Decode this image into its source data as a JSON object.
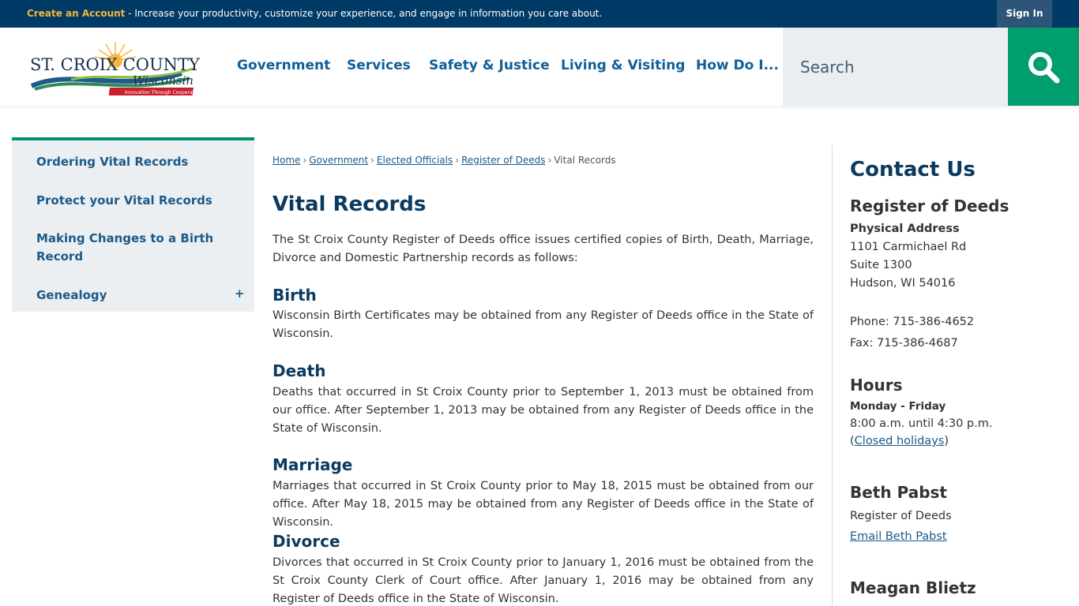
{
  "topbar": {
    "create_account": "Create an Account",
    "message": " - Increase your productivity, customize your experience, and engage in information you care about.",
    "sign_in": "Sign In"
  },
  "logo": {
    "line1": "ST. CROIX COUNTY",
    "line2": "Wisconsin",
    "tagline": "Innovation Through Cooperation"
  },
  "nav": {
    "items": [
      "Government",
      "Services",
      "Safety & Justice",
      "Living & Visiting",
      "How Do I..."
    ]
  },
  "search": {
    "placeholder": "Search"
  },
  "sidebar": {
    "items": [
      {
        "label": "Ordering Vital Records"
      },
      {
        "label": "Protect your Vital Records"
      },
      {
        "label": "Making Changes to a Birth Record"
      },
      {
        "label": "Genealogy"
      }
    ],
    "expand_symbol": "+"
  },
  "breadcrumb": {
    "links": [
      "Home",
      "Government",
      "Elected Officials",
      "Register of Deeds"
    ],
    "current": "Vital Records",
    "separator": "›"
  },
  "main": {
    "title": "Vital Records",
    "intro": "The St Croix County Register of Deeds office issues certified copies of Birth, Death, Marriage, Divorce and Domestic Partnership records as follows:",
    "sections": [
      {
        "heading": "Birth",
        "text": "Wisconsin Birth Certificates may be obtained from any Register of Deeds office in the State of Wisconsin."
      },
      {
        "heading": "Death",
        "text": "Deaths that occurred in St Croix County prior to September 1, 2013 must be obtained from our office. After September 1, 2013 may be obtained from any Register of Deeds office in the State of Wisconsin."
      },
      {
        "heading": "Marriage",
        "text": "Marriages that occurred in St Croix County prior to May 18, 2015 must be obtained from our office. After May 18, 2015 may be obtained from any Register of Deeds office in the State of Wisconsin."
      },
      {
        "heading": "Divorce",
        "text": "Divorces that occurred in St Croix County prior to January 1, 2016 must be obtained from the St Croix County Clerk of Court office. After January 1, 2016 may be obtained from any Register of Deeds office in the State of Wisconsin."
      }
    ]
  },
  "contact": {
    "title": "Contact Us",
    "dept": "Register of Deeds",
    "address_label": "Physical Address",
    "address": [
      "1101 Carmichael Rd",
      "Suite 1300",
      "Hudson, WI 54016"
    ],
    "phone": "Phone: 715-386-4652",
    "fax": "Fax: 715-386-4687",
    "hours_title": "Hours",
    "hours_days": "Monday - Friday",
    "hours_time": "8:00 a.m. until 4:30 p.m.",
    "holidays_open": "(",
    "holidays_link": "Closed holidays",
    "holidays_close": ")",
    "person1_name": "Beth Pabst",
    "person1_title": "Register of Deeds",
    "person1_email": "Email Beth Pabst",
    "person2_name": "Meagan Blietz"
  },
  "colors": {
    "topbar": "#003a66",
    "accent_green": "#009e6e",
    "nav_blue": "#0f5f99",
    "heading_navy": "#0b3a60",
    "create_account_gold": "#f5b83d"
  }
}
